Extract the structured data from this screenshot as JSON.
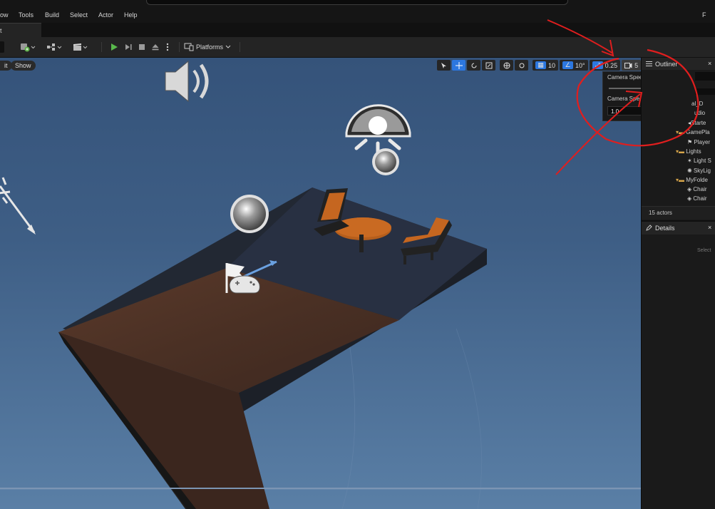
{
  "menu": {
    "items": [
      "ow",
      "Tools",
      "Build",
      "Select",
      "Actor",
      "Help"
    ],
    "right_label": "F"
  },
  "tab": {
    "label": "t"
  },
  "toolbar": {
    "platforms_label": "Platforms"
  },
  "viewport": {
    "perspective_label": "it",
    "show_label": "Show",
    "grid_snap": "10",
    "rotation_snap": "10°",
    "scale_snap": "0.25",
    "camera_speed_button": "5"
  },
  "camera_popup": {
    "speed_label": "Camera Speed",
    "speed_value": "5",
    "speed_fraction": 0.55,
    "scalar_label": "Camera Speed Scalar",
    "scalar_value": "1.0"
  },
  "outliner": {
    "title": "Outliner",
    "items": [
      "al_D",
      "udio",
      "Starte",
      "GamePla",
      "Player",
      "Lights",
      "Light S",
      "SkyLig",
      "MyFolde",
      "Chair",
      "Chair"
    ],
    "actor_count": "15 actors"
  },
  "details": {
    "title": "Details",
    "hint": "Select"
  },
  "colors": {
    "accent": "#2c77e0",
    "annotation": "#e01e1e",
    "sky": "#4a6b92"
  }
}
